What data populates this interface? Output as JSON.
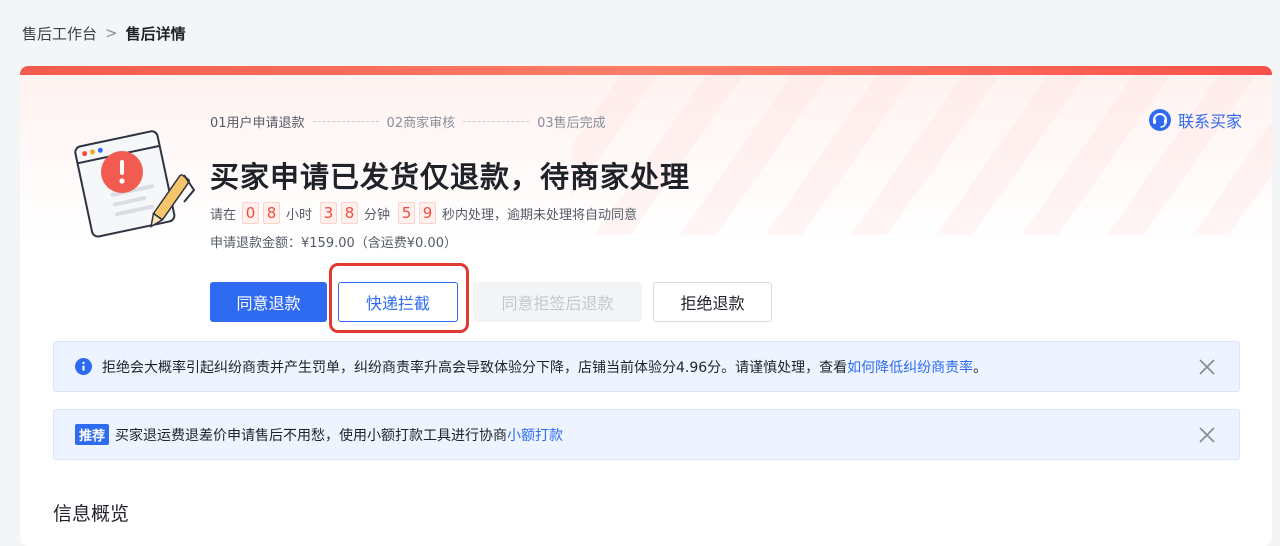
{
  "breadcrumb": {
    "parent": "售后工作台",
    "separator": ">",
    "current": "售后详情"
  },
  "steps": [
    {
      "label": "01用户申请退款",
      "active": true
    },
    {
      "label": "02商家审核",
      "active": false
    },
    {
      "label": "03售后完成",
      "active": false
    }
  ],
  "contact": {
    "label": "联系买家",
    "icon": "customer-service-icon"
  },
  "status": {
    "title": "买家申请已发货仅退款，待商家处理",
    "countdown_prefix": "请在",
    "hours": [
      "0",
      "8"
    ],
    "hours_unit": "小时",
    "minutes": [
      "3",
      "8"
    ],
    "minutes_unit": "分钟",
    "seconds": [
      "5",
      "9"
    ],
    "seconds_suffix": "秒内处理，逾期未处理将自动同意",
    "amount_text": "申请退款金额：¥159.00（含运费¥0.00）"
  },
  "actions": {
    "agree": "同意退款",
    "intercept": "快递拦截",
    "agree_after_reject_sign": "同意拒签后退款",
    "reject": "拒绝退款"
  },
  "notices": {
    "warning": {
      "text": "拒绝会大概率引起纠纷商责并产生罚单，纠纷商责率升高会导致体验分下降，店铺当前体验分4.96分。请谨慎处理，查看",
      "link": "如何降低纠纷商责率",
      "end": "。"
    },
    "recommend": {
      "tag": "推荐",
      "text": "买家退运费退差价申请售后不用愁，使用小额打款工具进行协商",
      "link": "小额打款"
    }
  },
  "section": {
    "title": "信息概览"
  },
  "colors": {
    "primary": "#2f6bf0",
    "danger": "#f04c3e",
    "highlight_box": "#e03a32"
  }
}
